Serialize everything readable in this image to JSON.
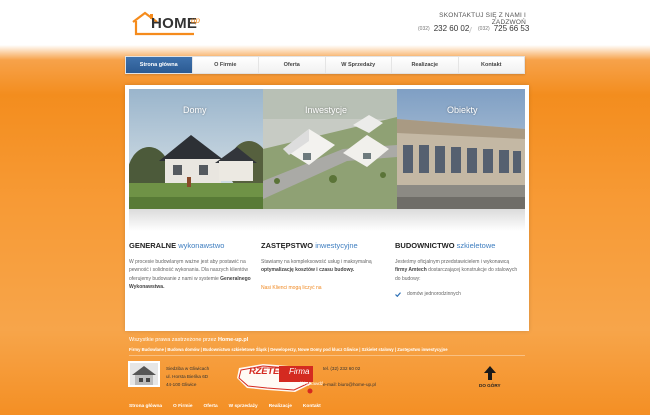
{
  "header": {
    "logo_text": "HOME",
    "logo_suffix": "up",
    "contact_title": "SKONTAKTUJ SIĘ Z NAMI I ZADZWOŃ",
    "phone1_prefix": "(032)",
    "phone1": "232 60 02",
    "phone2_prefix": "(032)",
    "phone2": "725 66 53"
  },
  "nav": {
    "items": [
      {
        "label": "Strona główna"
      },
      {
        "label": "O Firmie"
      },
      {
        "label": "Oferta"
      },
      {
        "label": "W Sprzedaży"
      },
      {
        "label": "Realizacje"
      },
      {
        "label": "Kontakt"
      }
    ],
    "active_index": 0
  },
  "banner": {
    "slides": [
      {
        "title": "Domy"
      },
      {
        "title": "Inwestycje"
      },
      {
        "title": "Obiekty"
      }
    ]
  },
  "columns": [
    {
      "heading_bold": "GENERALNE",
      "heading_accent": "wykonawstwo",
      "text_1": "W procesie budowlanym ważne jest aby postawić na pewność i solidność wykonania. Dla naszych klientów oferujemy budowanie z nami w systemie ",
      "text_bold": "Generalnego Wykonawstwa."
    },
    {
      "heading_bold": "ZASTĘPSTWO",
      "heading_accent": "inwestycyjne",
      "text_1": "Stawiamy na kompleksowość usług i maksymalną ",
      "text_bold": "optymalizację kosztów i czasu budowy.",
      "link": "Nasi Klienci mogą liczyć na"
    },
    {
      "heading_bold": "BUDOWNICTWO",
      "heading_accent": "szkieletowe",
      "text_1": "Jesteśmy oficjalnym przedstawicielem i wykonawcą ",
      "text_bold": "firmy Amtech",
      "text_2": " dostarczającej konstrukcje do stalowych do budowy:",
      "check_item": "domów jednorodzinnych"
    }
  ],
  "footer": {
    "copyright_prefix": "Wszystkie prawa zastrzeżone przez ",
    "copyright_brand": "Home-up.pl",
    "links_line": "Firmy Budowlane | Budowa domów | Budownictwo szkieletowe Śląsk | Deweloperzy, Nowe Domy pod klucz Gliwice | Szkielet stalowy | Zastępstwo inwestycyjne",
    "address": [
      "Siedziba w Gliwicach",
      "ul. Horsta Bieńka 6D",
      "44-100 Gliwice"
    ],
    "badge_word1": "RZETELNA",
    "badge_word2": "Firma",
    "badge_slogan": "sprawdź i sprawdź",
    "contact": [
      "tel. (32) 232 60 02",
      "",
      "e-mail: biuro@home-up.pl"
    ],
    "top_label": "DO GÓRY",
    "bottom_links": [
      "Strona główna",
      "O Firmie",
      "Oferta",
      "W sprzedaży",
      "Realizacje",
      "Kontakt"
    ]
  },
  "colors": {
    "accent": "#f58b1c",
    "nav_active": "#2f5f98",
    "heading_accent": "#3e7ec0"
  }
}
